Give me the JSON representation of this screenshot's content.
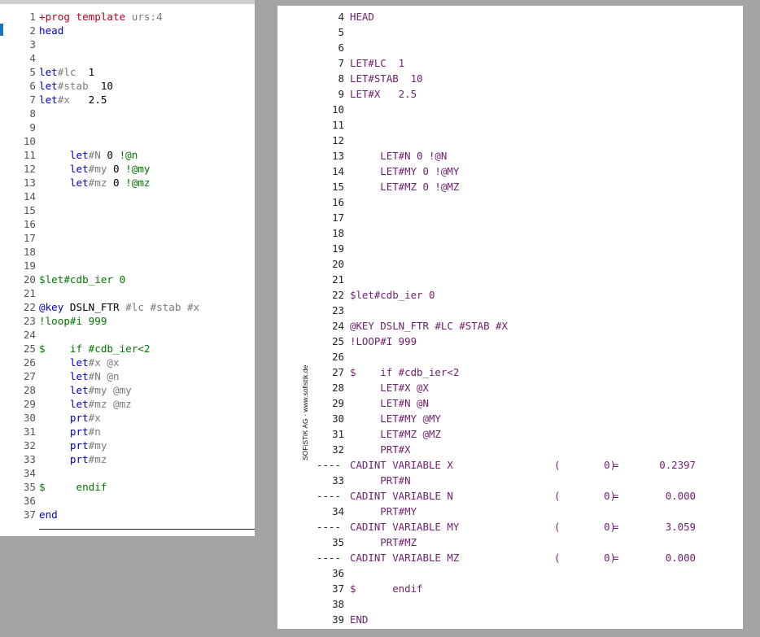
{
  "editor": {
    "lines": [
      {
        "n": "1",
        "segs": [
          [
            "red",
            "+prog template "
          ],
          [
            "gray",
            "urs:4"
          ]
        ]
      },
      {
        "n": "2",
        "segs": [
          [
            "kw",
            "head"
          ]
        ]
      },
      {
        "n": "3",
        "segs": []
      },
      {
        "n": "4",
        "segs": []
      },
      {
        "n": "5",
        "segs": [
          [
            "kw",
            "let"
          ],
          [
            "gray",
            "#lc"
          ],
          [
            "blk",
            "  1"
          ]
        ]
      },
      {
        "n": "6",
        "segs": [
          [
            "kw",
            "let"
          ],
          [
            "gray",
            "#stab"
          ],
          [
            "blk",
            "  10"
          ]
        ]
      },
      {
        "n": "7",
        "segs": [
          [
            "kw",
            "let"
          ],
          [
            "gray",
            "#x"
          ],
          [
            "blk",
            "   2.5"
          ]
        ]
      },
      {
        "n": "8",
        "segs": []
      },
      {
        "n": "9",
        "segs": []
      },
      {
        "n": "10",
        "segs": []
      },
      {
        "n": "11",
        "segs": [
          [
            "blk",
            "     "
          ],
          [
            "kw",
            "let"
          ],
          [
            "gray",
            "#N"
          ],
          [
            "blk",
            " 0 "
          ],
          [
            "green",
            "!@n"
          ]
        ]
      },
      {
        "n": "12",
        "segs": [
          [
            "blk",
            "     "
          ],
          [
            "kw",
            "let"
          ],
          [
            "gray",
            "#my"
          ],
          [
            "blk",
            " 0 "
          ],
          [
            "green",
            "!@my"
          ]
        ]
      },
      {
        "n": "13",
        "segs": [
          [
            "blk",
            "     "
          ],
          [
            "kw",
            "let"
          ],
          [
            "gray",
            "#mz"
          ],
          [
            "blk",
            " 0 "
          ],
          [
            "green",
            "!@mz"
          ]
        ]
      },
      {
        "n": "14",
        "segs": []
      },
      {
        "n": "15",
        "segs": []
      },
      {
        "n": "16",
        "segs": []
      },
      {
        "n": "17",
        "segs": []
      },
      {
        "n": "18",
        "segs": []
      },
      {
        "n": "19",
        "segs": []
      },
      {
        "n": "20",
        "segs": [
          [
            "green",
            "$let#cdb_ier 0"
          ]
        ]
      },
      {
        "n": "21",
        "segs": []
      },
      {
        "n": "22",
        "segs": [
          [
            "kw",
            "@key"
          ],
          [
            "blk",
            " DSLN_FTR "
          ],
          [
            "gray",
            "#lc #stab #x"
          ]
        ]
      },
      {
        "n": "23",
        "segs": [
          [
            "green",
            "!loop#i 999"
          ]
        ]
      },
      {
        "n": "24",
        "segs": []
      },
      {
        "n": "25",
        "segs": [
          [
            "green",
            "$    if #cdb_ier<2"
          ]
        ]
      },
      {
        "n": "26",
        "segs": [
          [
            "blk",
            "     "
          ],
          [
            "kw",
            "let"
          ],
          [
            "gray",
            "#x @x"
          ]
        ]
      },
      {
        "n": "27",
        "segs": [
          [
            "blk",
            "     "
          ],
          [
            "kw",
            "let"
          ],
          [
            "gray",
            "#N @n"
          ]
        ]
      },
      {
        "n": "28",
        "segs": [
          [
            "blk",
            "     "
          ],
          [
            "kw",
            "let"
          ],
          [
            "gray",
            "#my @my"
          ]
        ]
      },
      {
        "n": "29",
        "segs": [
          [
            "blk",
            "     "
          ],
          [
            "kw",
            "let"
          ],
          [
            "gray",
            "#mz @mz"
          ]
        ]
      },
      {
        "n": "30",
        "segs": [
          [
            "blk",
            "     "
          ],
          [
            "kw",
            "prt"
          ],
          [
            "gray",
            "#x"
          ]
        ]
      },
      {
        "n": "31",
        "segs": [
          [
            "blk",
            "     "
          ],
          [
            "kw",
            "prt"
          ],
          [
            "gray",
            "#n"
          ]
        ]
      },
      {
        "n": "32",
        "segs": [
          [
            "blk",
            "     "
          ],
          [
            "kw",
            "prt"
          ],
          [
            "gray",
            "#my"
          ]
        ]
      },
      {
        "n": "33",
        "segs": [
          [
            "blk",
            "     "
          ],
          [
            "kw",
            "prt"
          ],
          [
            "gray",
            "#mz"
          ]
        ]
      },
      {
        "n": "34",
        "segs": []
      },
      {
        "n": "35",
        "segs": [
          [
            "green",
            "$     endif"
          ]
        ]
      },
      {
        "n": "36",
        "segs": []
      },
      {
        "n": "37",
        "segs": [
          [
            "kw",
            "end"
          ]
        ]
      }
    ]
  },
  "output": {
    "watermark": "SOFiSTiK AG · www.sofistik.de",
    "lines": [
      {
        "n": "4",
        "text": "HEAD"
      },
      {
        "n": "5",
        "text": ""
      },
      {
        "n": "6",
        "text": ""
      },
      {
        "n": "7",
        "text": "LET#LC  1"
      },
      {
        "n": "8",
        "text": "LET#STAB  10"
      },
      {
        "n": "9",
        "text": "LET#X   2.5"
      },
      {
        "n": "10",
        "text": ""
      },
      {
        "n": "11",
        "text": ""
      },
      {
        "n": "12",
        "text": ""
      },
      {
        "n": "13",
        "text": "     LET#N 0 !@N"
      },
      {
        "n": "14",
        "text": "     LET#MY 0 !@MY"
      },
      {
        "n": "15",
        "text": "     LET#MZ 0 !@MZ"
      },
      {
        "n": "16",
        "text": ""
      },
      {
        "n": "17",
        "text": ""
      },
      {
        "n": "18",
        "text": ""
      },
      {
        "n": "19",
        "text": ""
      },
      {
        "n": "20",
        "text": ""
      },
      {
        "n": "21",
        "text": ""
      },
      {
        "n": "22",
        "text": "$let#cdb_ier 0"
      },
      {
        "n": "23",
        "text": ""
      },
      {
        "n": "24",
        "text": "@KEY DSLN_FTR #LC #STAB #X"
      },
      {
        "n": "25",
        "text": "!LOOP#I 999"
      },
      {
        "n": "26",
        "text": ""
      },
      {
        "n": "27",
        "text": "$    if #cdb_ier<2"
      },
      {
        "n": "28",
        "text": "     LET#X @X"
      },
      {
        "n": "29",
        "text": "     LET#N @N"
      },
      {
        "n": "30",
        "text": "     LET#MY @MY"
      },
      {
        "n": "31",
        "text": "     LET#MZ @MZ"
      },
      {
        "n": "32",
        "text": "     PRT#X"
      },
      {
        "dash": "----",
        "text": "CADINT VARIABLE X",
        "paren": "(",
        "idx": "0)",
        "eq": "=",
        "val": "0.2397"
      },
      {
        "n": "33",
        "text": "     PRT#N"
      },
      {
        "dash": "----",
        "text": "CADINT VARIABLE N",
        "paren": "(",
        "idx": "0)",
        "eq": "=",
        "val": "0.000"
      },
      {
        "n": "34",
        "text": "     PRT#MY"
      },
      {
        "dash": "----",
        "text": "CADINT VARIABLE MY",
        "paren": "(",
        "idx": "0)",
        "eq": "=",
        "val": "3.059"
      },
      {
        "n": "35",
        "text": "     PRT#MZ"
      },
      {
        "dash": "----",
        "text": "CADINT VARIABLE MZ",
        "paren": "(",
        "idx": "0)",
        "eq": "=",
        "val": "0.000"
      },
      {
        "n": "36",
        "text": ""
      },
      {
        "n": "37",
        "text": "$      endif"
      },
      {
        "n": "38",
        "text": ""
      },
      {
        "n": "39",
        "text": "END"
      }
    ]
  }
}
